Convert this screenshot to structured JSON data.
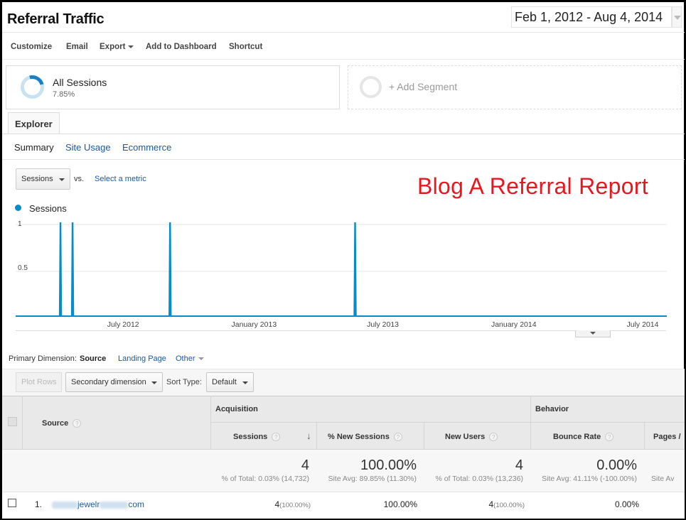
{
  "header": {
    "title": "Referral Traffic",
    "date_range": "Feb 1, 2012 - Aug 4, 2014"
  },
  "toolbar": {
    "customize": "Customize",
    "email": "Email",
    "export": "Export",
    "add_to_dashboard": "Add to Dashboard",
    "shortcut": "Shortcut"
  },
  "segments": {
    "active": {
      "name": "All Sessions",
      "percent": "7.85%",
      "fill_fraction": 0.0785
    },
    "add_label": "+ Add Segment"
  },
  "tabs": {
    "explorer": "Explorer",
    "subtabs": [
      "Summary",
      "Site Usage",
      "Ecommerce"
    ]
  },
  "metric": {
    "selected": "Sessions",
    "vs": "vs.",
    "select_metric": "Select a metric"
  },
  "annotation": "Blog A Referral Report",
  "chart_data": {
    "type": "line",
    "series": [
      {
        "name": "Sessions",
        "color": "#058dc7",
        "spikes": [
          "2012-04-04",
          "2012-04-21",
          "2012-09-05",
          "2013-05-23"
        ],
        "spike_value": 1
      }
    ],
    "x_range": [
      "2012-02-01",
      "2014-08-04"
    ],
    "x_ticks": [
      "July 2012",
      "January 2013",
      "July 2013",
      "January 2014",
      "July 2014"
    ],
    "x_tick_dates": [
      "2012-07-01",
      "2013-01-01",
      "2013-07-01",
      "2014-01-01",
      "2014-07-01"
    ],
    "y_ticks": [
      "1",
      "0.5"
    ],
    "y_tick_values": [
      1,
      0.5
    ],
    "ylim": [
      0,
      1
    ],
    "grid": true,
    "legend": "top-left"
  },
  "primary_dimension": {
    "label": "Primary Dimension:",
    "selected": "Source",
    "options": [
      "Landing Page",
      "Other"
    ]
  },
  "controls": {
    "plot_rows": "Plot Rows",
    "secondary_dimension": "Secondary dimension",
    "sort_type_label": "Sort Type:",
    "sort_type": "Default"
  },
  "table": {
    "source_header": "Source",
    "groups": {
      "acquisition": "Acquisition",
      "behavior": "Behavior"
    },
    "columns": [
      "Sessions",
      "% New Sessions",
      "New Users",
      "Bounce Rate",
      "Pages /"
    ],
    "totals": {
      "sessions": "4",
      "sessions_sub": "% of Total: 0.03% (14,732)",
      "new_sessions": "100.00%",
      "new_sessions_sub": "Site Avg: 89.85% (11.30%)",
      "new_users": "4",
      "new_users_sub": "% of Total: 0.03% (13,236)",
      "bounce": "0.00%",
      "bounce_sub": "Site Avg: 41.11% (-100.00%)",
      "pages_sub": "Site Av"
    },
    "rows": [
      {
        "index": "1.",
        "source_visible": "jewelr",
        "source_suffix": "com",
        "sessions": "4",
        "sessions_pct": "(100.00%)",
        "new_sessions": "100.00%",
        "new_users": "4",
        "new_users_pct": "(100.00%)",
        "bounce": "0.00%"
      }
    ]
  }
}
